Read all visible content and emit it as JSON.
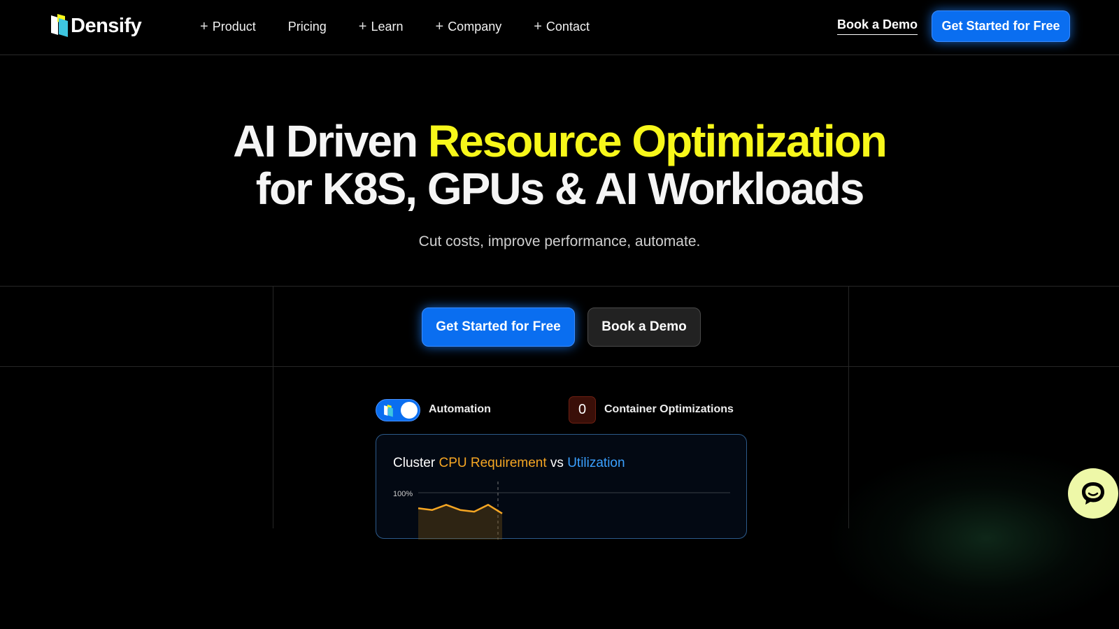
{
  "header": {
    "logo_text": "Densify",
    "nav": [
      {
        "label": "Product",
        "expandable": true
      },
      {
        "label": "Pricing",
        "expandable": false
      },
      {
        "label": "Learn",
        "expandable": true
      },
      {
        "label": "Company",
        "expandable": true
      },
      {
        "label": "Contact",
        "expandable": true
      }
    ],
    "book_demo": "Book a Demo",
    "cta": "Get Started for Free"
  },
  "hero": {
    "title_part1": "AI Driven ",
    "title_highlight": "Resource Optimization",
    "title_line2": "for K8S, GPUs & AI Workloads",
    "subtitle": "Cut costs, improve performance, automate.",
    "cta_primary": "Get Started for Free",
    "cta_secondary": "Book a Demo"
  },
  "controls": {
    "automation_label": "Automation",
    "automation_on": true,
    "optimizations_count": "0",
    "optimizations_label": "Container Optimizations"
  },
  "chart": {
    "title_prefix": "Cluster ",
    "title_requirement": "CPU Requirement",
    "title_vs": " vs ",
    "title_utilization": "Utilization"
  },
  "chart_data": {
    "type": "area",
    "y_tick_label": "100%",
    "series": [
      {
        "values": [
          91,
          90,
          93,
          90,
          89,
          93,
          88
        ]
      }
    ],
    "colors": {
      "requirement": "#f5a623",
      "utilization": "#3aa0ff"
    }
  },
  "colors": {
    "accent_blue": "#0a6ef0",
    "highlight_yellow": "#f7f71a",
    "chat_bubble": "#eef8a8"
  }
}
